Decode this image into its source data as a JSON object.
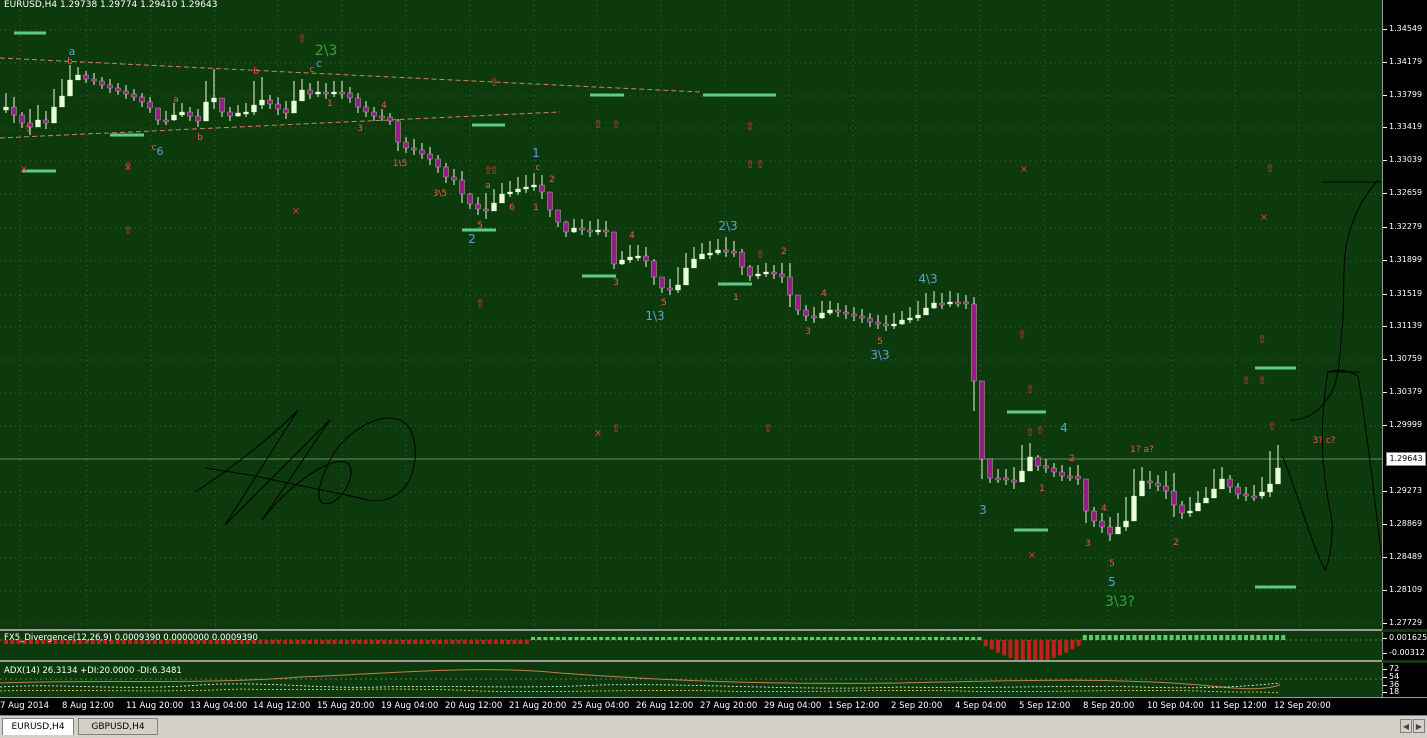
{
  "chart": {
    "title": "EURUSD,H4  1.29738 1.29774 1.29410 1.29643",
    "current_price": "1.29643",
    "price_labels": [
      "1.34549",
      "1.34179",
      "1.33799",
      "1.33419",
      "1.33039",
      "1.32659",
      "1.32279",
      "1.31899",
      "1.31519",
      "1.31139",
      "1.30759",
      "1.30379",
      "1.29999",
      "1.29273",
      "1.28869",
      "1.28489",
      "1.28109",
      "1.27729"
    ],
    "time_labels": [
      "7 Aug 2014",
      "8 Aug 12:00",
      "11 Aug 20:00",
      "13 Aug 04:00",
      "14 Aug 12:00",
      "15 Aug 20:00",
      "19 Aug 04:00",
      "20 Aug 12:00",
      "21 Aug 20:00",
      "25 Aug 04:00",
      "26 Aug 12:00",
      "27 Aug 20:00",
      "29 Aug 04:00",
      "1 Sep 12:00",
      "2 Sep 20:00",
      "4 Sep 04:00",
      "5 Sep 12:00",
      "8 Sep 20:00",
      "10 Sep 04:00",
      "11 Sep 12:00",
      "12 Sep 20:00"
    ],
    "colors": {
      "background": "#0c3a0c",
      "bull_candle": "#e8ffd8",
      "bear_candle": "#9b1b8a",
      "grid": "#2f6a2f",
      "level_lines": "#5fc98a",
      "annotation_red": "#ff3030",
      "wave_blue": "#5aa0d8",
      "channel": "#d08060"
    }
  },
  "wave_labels": [
    "a",
    "b",
    "c",
    "6",
    "b",
    "2\\3",
    "c",
    "c",
    "a",
    "b",
    "1",
    "3",
    "4",
    "1\\5",
    "3\\5",
    "a",
    "2",
    "1",
    "6",
    "1",
    "5",
    "2",
    "c",
    "4",
    "3",
    "5",
    "1\\3",
    "2\\3",
    "1",
    "2",
    "4",
    "3",
    "5",
    "3\\3",
    "4\\3",
    "3",
    "1",
    "4",
    "2",
    "3",
    "4",
    "5",
    "5",
    "3\\3?",
    "2",
    "1? a?",
    "3? c?"
  ],
  "indicators": {
    "divergence": {
      "title": "FX5_Divergence(12,26,9) 0.0009390 0.0000000 0.0009390",
      "labels": [
        "0.001625",
        "-0.00312"
      ]
    },
    "adx": {
      "title": "ADX(14) 26.3134 +DI:20.0000 -DI:6.3481",
      "labels": [
        "72",
        "54",
        "36",
        "18"
      ]
    }
  },
  "tabs": [
    {
      "label": "EURUSD,H4",
      "active": true
    },
    {
      "label": "GBPUSD,H4",
      "active": false
    }
  ]
}
